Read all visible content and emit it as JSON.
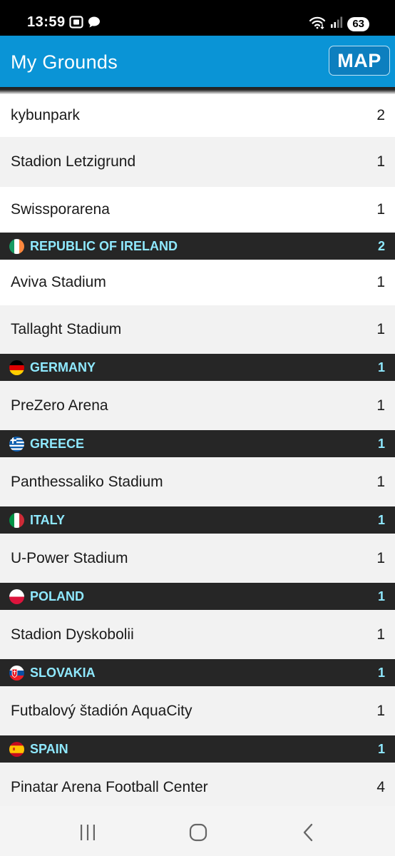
{
  "status_bar": {
    "time": "13:59",
    "battery": "63",
    "left_icons": [
      "screenshot-icon",
      "chat-bubble-icon"
    ],
    "right_icons": [
      "wifi-icon",
      "signal-icon"
    ]
  },
  "app_bar": {
    "title": "My Grounds",
    "map_button_label": "MAP"
  },
  "rows": [
    {
      "type": "ground",
      "name": "kybunpark",
      "count": "2",
      "bg": "#ffffff",
      "h": 60
    },
    {
      "type": "ground",
      "name": "Stadion Letzigrund",
      "count": "1",
      "bg": "#f2f2f2",
      "h": 70
    },
    {
      "type": "ground",
      "name": "Swissporarena",
      "count": "1",
      "bg": "#ffffff",
      "h": 64
    },
    {
      "type": "country",
      "name": "REPUBLIC OF IRELAND",
      "count": "2",
      "flag": "ireland-flag-icon"
    },
    {
      "type": "ground",
      "name": "Aviva Stadium",
      "count": "1",
      "bg": "#ffffff",
      "h": 64
    },
    {
      "type": "ground",
      "name": "Tallaght Stadium",
      "count": "1",
      "bg": "#f2f2f2",
      "h": 68
    },
    {
      "type": "country",
      "name": "GERMANY",
      "count": "1",
      "flag": "germany-flag-icon"
    },
    {
      "type": "ground",
      "name": "PreZero Arena",
      "count": "1",
      "bg": "#f2f2f2",
      "h": 69
    },
    {
      "type": "country",
      "name": "GREECE",
      "count": "1",
      "flag": "greece-flag-icon"
    },
    {
      "type": "ground",
      "name": "Panthessaliko Stadium",
      "count": "1",
      "bg": "#f2f2f2",
      "h": 69
    },
    {
      "type": "country",
      "name": "ITALY",
      "count": "1",
      "flag": "italy-flag-icon"
    },
    {
      "type": "ground",
      "name": "U-Power Stadium",
      "count": "1",
      "bg": "#f2f2f2",
      "h": 69
    },
    {
      "type": "country",
      "name": "POLAND",
      "count": "1",
      "flag": "poland-flag-icon"
    },
    {
      "type": "ground",
      "name": "Stadion Dyskobolii",
      "count": "1",
      "bg": "#f2f2f2",
      "h": 69
    },
    {
      "type": "country",
      "name": "SLOVAKIA",
      "count": "1",
      "flag": "slovakia-flag-icon"
    },
    {
      "type": "ground",
      "name": "Futbalový štadión AquaCity",
      "count": "1",
      "bg": "#f2f2f2",
      "h": 69
    },
    {
      "type": "country",
      "name": "SPAIN",
      "count": "1",
      "flag": "spain-flag-icon"
    },
    {
      "type": "ground",
      "name": "Pinatar Arena Football Center",
      "count": "4",
      "bg": "#f2f2f2",
      "h": 69
    }
  ],
  "nav_bar": {
    "icons": [
      "recent-apps-icon",
      "home-icon",
      "back-icon"
    ]
  }
}
